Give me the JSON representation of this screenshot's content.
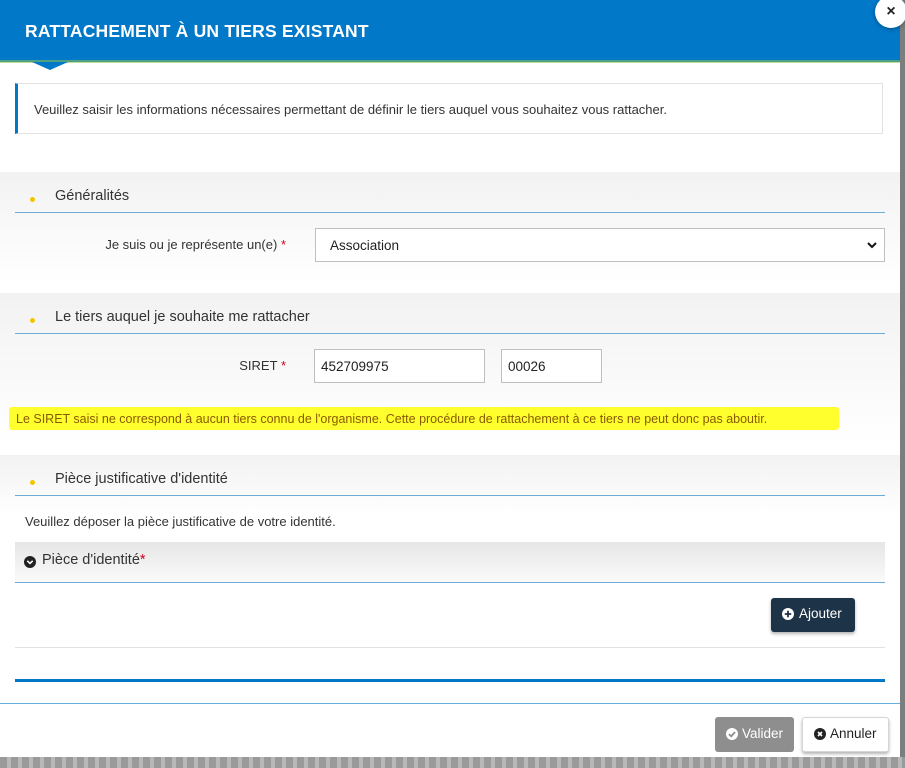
{
  "modal": {
    "title": "RATTACHEMENT À UN TIERS EXISTANT",
    "close_label": "×",
    "info": "Veuillez saisir les informations nécessaires permettant de définir le tiers auquel vous souhaitez vous rattacher."
  },
  "sections": {
    "generalites": {
      "title": "Généralités",
      "field_label": "Je suis ou je représente un(e)",
      "required_mark": "*",
      "select_value": "Association"
    },
    "tiers": {
      "title": "Le tiers auquel je souhaite me rattacher",
      "siret_label": "SIRET",
      "required_mark": "*",
      "siren_value": "452709975",
      "nic_value": "00026",
      "error": "Le SIRET saisi ne correspond à aucun tiers connu de l'organisme. Cette procédure de rattachement à ce tiers ne peut donc pas aboutir."
    },
    "piece": {
      "title": "Pièce justificative d'identité",
      "help": "Veuillez déposer la pièce justificative de votre identité.",
      "panel_title": "Pièce d'identité",
      "required_mark": "*",
      "add_label": "Ajouter"
    }
  },
  "footer": {
    "validate_label": "Valider",
    "cancel_label": "Annuler"
  },
  "colors": {
    "header": "#0178c8",
    "bullet": "#f2c500",
    "highlight": "#ffff2e",
    "required": "#d0021b",
    "dark_button": "#1d3347"
  }
}
